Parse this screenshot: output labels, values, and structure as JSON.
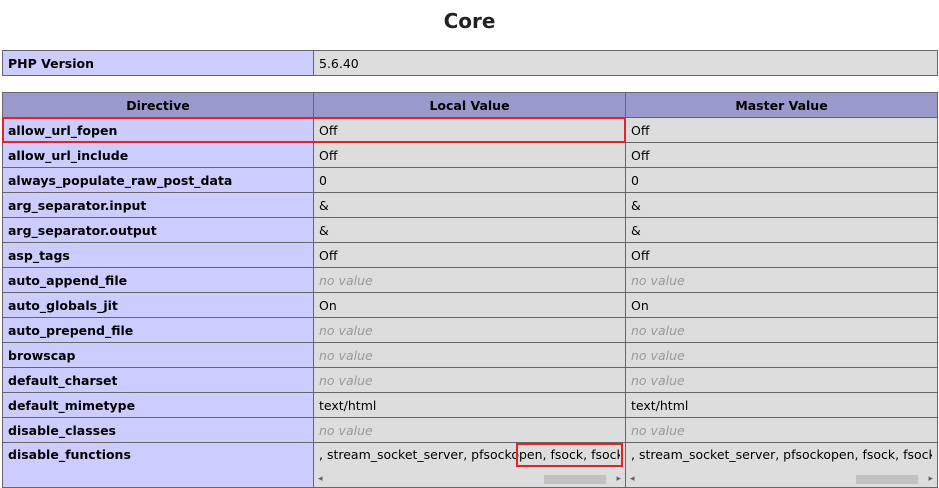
{
  "page": {
    "title": "Core"
  },
  "version_table": {
    "label": "PHP Version",
    "value": "5.6.40"
  },
  "directives_table": {
    "headers": [
      "Directive",
      "Local Value",
      "Master Value"
    ],
    "rows": [
      {
        "name": "allow_url_fopen",
        "local": "Off",
        "master": "Off"
      },
      {
        "name": "allow_url_include",
        "local": "Off",
        "master": "Off"
      },
      {
        "name": "always_populate_raw_post_data",
        "local": "0",
        "master": "0"
      },
      {
        "name": "arg_separator.input",
        "local": "&",
        "master": "&"
      },
      {
        "name": "arg_separator.output",
        "local": "&",
        "master": "&"
      },
      {
        "name": "asp_tags",
        "local": "Off",
        "master": "Off"
      },
      {
        "name": "auto_append_file",
        "local": "no value",
        "master": "no value"
      },
      {
        "name": "auto_globals_jit",
        "local": "On",
        "master": "On"
      },
      {
        "name": "auto_prepend_file",
        "local": "no value",
        "master": "no value"
      },
      {
        "name": "browscap",
        "local": "no value",
        "master": "no value"
      },
      {
        "name": "default_charset",
        "local": "no value",
        "master": "no value"
      },
      {
        "name": "default_mimetype",
        "local": "text/html",
        "master": "text/html"
      },
      {
        "name": "disable_classes",
        "local": "no value",
        "master": "no value"
      },
      {
        "name": "disable_functions",
        "local": ", stream_socket_server, pfsockopen, fsock, fsockopen",
        "master": ", stream_socket_server, pfsockopen, fsock, fsockopen"
      }
    ]
  },
  "icons": {
    "scroll_left": "◂",
    "scroll_right": "▸"
  },
  "colors": {
    "header_bg": "#9999cc",
    "directive_bg": "#ccccff",
    "value_bg": "#dddddd",
    "highlight": "#e0242b"
  }
}
